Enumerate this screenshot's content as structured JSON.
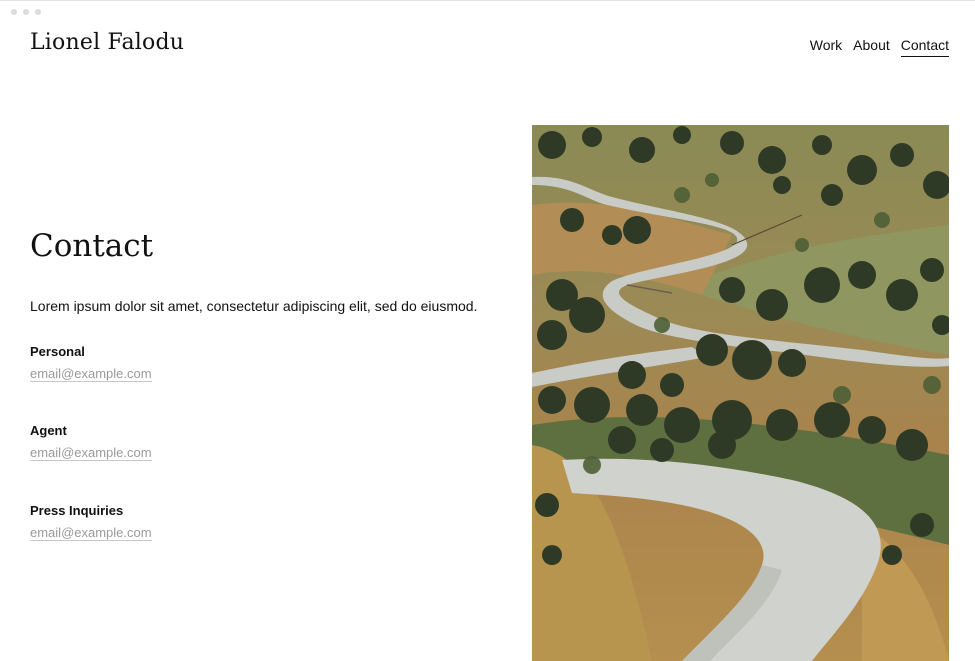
{
  "header": {
    "site_title": "Lionel Falodu",
    "nav": [
      {
        "label": "Work",
        "active": false
      },
      {
        "label": "About",
        "active": false
      },
      {
        "label": "Contact",
        "active": true
      }
    ]
  },
  "main": {
    "heading": "Contact",
    "intro": "Lorem ipsum dolor sit amet, consectetur adipiscing elit, sed do eiusmod.",
    "contacts": [
      {
        "label": "Personal",
        "email": "email@example.com"
      },
      {
        "label": "Agent",
        "email": "email@example.com"
      },
      {
        "label": "Press Inquiries",
        "email": "email@example.com"
      }
    ]
  },
  "colors": {
    "text": "#111111",
    "muted_link": "#9a9a9a",
    "background": "#ffffff"
  }
}
